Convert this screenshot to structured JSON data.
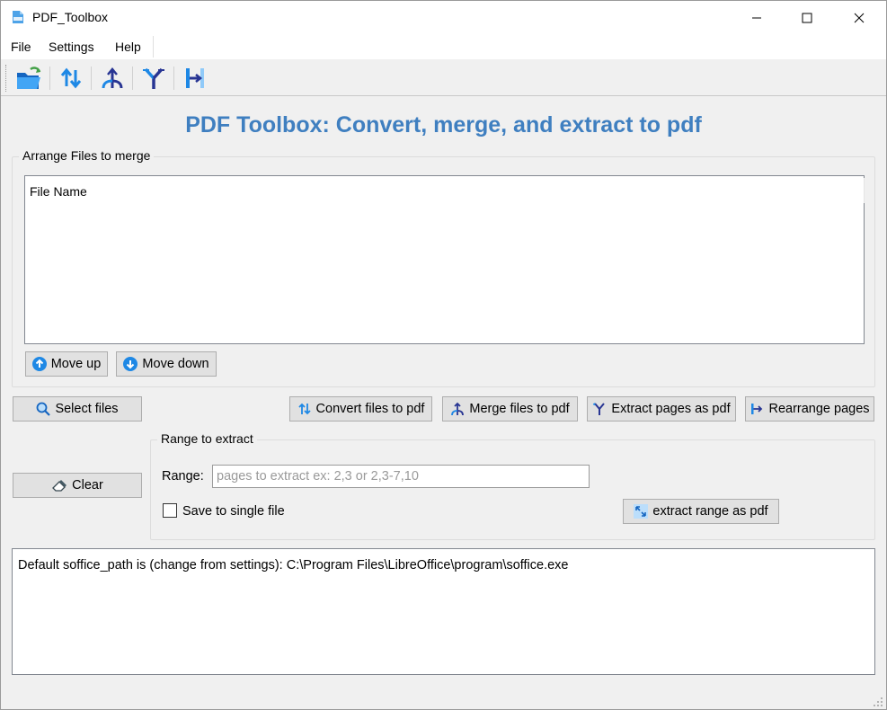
{
  "window": {
    "title": "PDF_Toolbox"
  },
  "menu": {
    "items": [
      "File",
      "Settings",
      "Help"
    ]
  },
  "toolbar": {
    "buttons": [
      "open-folder-icon",
      "convert-icon",
      "merge-icon",
      "extract-icon",
      "rearrange-icon"
    ]
  },
  "heading": "PDF Toolbox: Convert, merge, and extract to pdf",
  "arrange": {
    "group_title": "Arrange Files to merge",
    "list_header": "File Name",
    "move_up": "Move up",
    "move_down": "Move down"
  },
  "actions": {
    "select_files": "Select files",
    "convert": "Convert files to pdf",
    "merge": "Merge files to pdf",
    "extract": "Extract pages as pdf",
    "rearrange": "Rearrange pages",
    "clear": "Clear"
  },
  "range": {
    "group_title": "Range to extract",
    "label": "Range:",
    "value": "",
    "placeholder": "pages to extract ex: 2,3 or 2,3-7,10",
    "single_file_label": "Save to single file",
    "single_file_checked": false,
    "extract_button": "extract range as pdf"
  },
  "log": {
    "text": "Default soffice_path is (change from settings): C:\\Program Files\\LibreOffice\\program\\soffice.exe"
  },
  "colors": {
    "accent": "#3f7fc0",
    "icon_blue": "#1e88e5",
    "icon_dark": "#283593",
    "window_bg": "#f0f0f0"
  }
}
